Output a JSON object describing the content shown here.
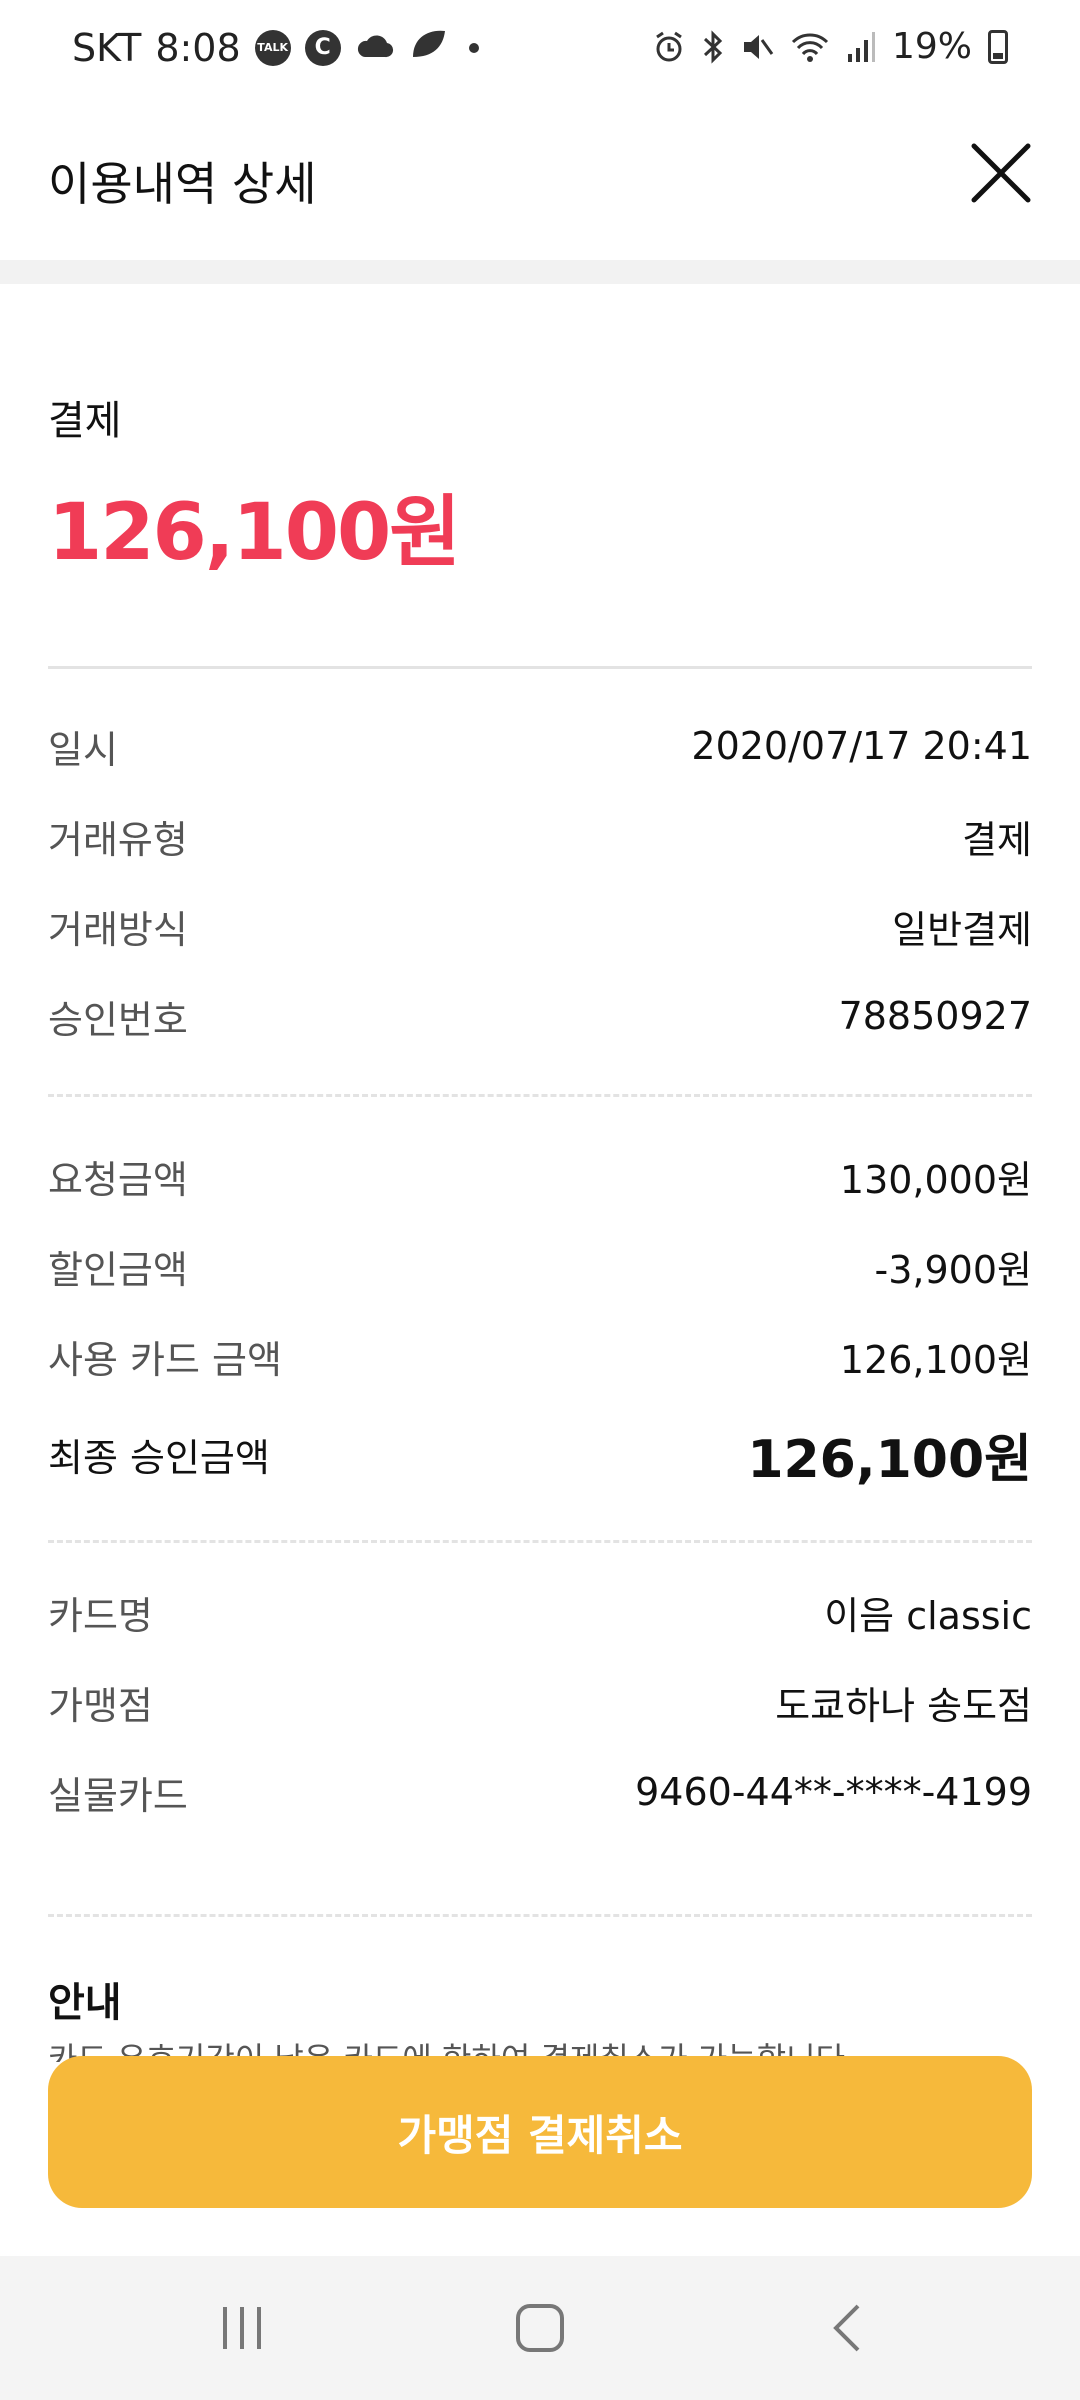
{
  "status_bar": {
    "carrier": "SKT",
    "time": "8:08",
    "notif_talk": "TALK",
    "notif_c": "C",
    "battery": "19%"
  },
  "header": {
    "title": "이용내역 상세"
  },
  "summary": {
    "label": "결제",
    "amount": "126,100원",
    "amount_color": "#f03c56"
  },
  "details": [
    {
      "label": "일시",
      "value": "2020/07/17 20:41"
    },
    {
      "label": "거래유형",
      "value": "결제"
    },
    {
      "label": "거래방식",
      "value": "일반결제"
    },
    {
      "label": "승인번호",
      "value": "78850927"
    }
  ],
  "amounts": [
    {
      "label": "요청금액",
      "value": "130,000원"
    },
    {
      "label": "할인금액",
      "value": "-3,900원"
    },
    {
      "label": "사용 카드 금액",
      "value": "126,100원"
    }
  ],
  "final": {
    "label": "최종 승인금액",
    "value": "126,100원"
  },
  "card_info": [
    {
      "label": "카드명",
      "value": "이음 classic"
    },
    {
      "label": "가맹점",
      "value": "도쿄하나 송도점"
    },
    {
      "label": "실물카드",
      "value": "9460-44**-****-4199"
    }
  ],
  "notice": {
    "title": "안내",
    "text": "카드 유효기간이 남은 카드에 한하여 결제취소가 가능합니다"
  },
  "cta": {
    "label": "가맹점 결제취소",
    "color": "#f6b93b"
  },
  "nav": {
    "icons": [
      "recents-icon",
      "home-icon",
      "back-icon"
    ]
  }
}
